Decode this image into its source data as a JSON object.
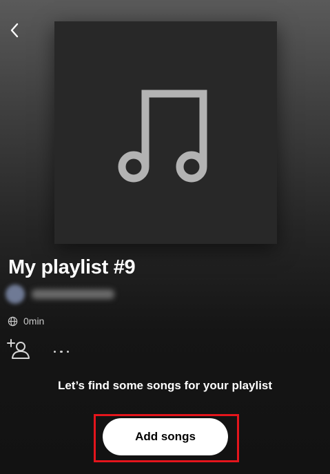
{
  "header": {
    "back_icon": "chevron-left-icon"
  },
  "cover": {
    "icon": "music-note-icon",
    "background_color": "#282828",
    "icon_color": "#b3b3b3"
  },
  "playlist": {
    "title": "My playlist #9",
    "duration": "0min",
    "visibility_icon": "globe-icon"
  },
  "actions": {
    "add_collaborator_icon": "add-user-icon",
    "more_icon": "more-dots-icon"
  },
  "empty_state": {
    "message": "Let’s find some songs for your playlist",
    "button_label": "Add songs"
  },
  "colors": {
    "highlight": "#e4151c",
    "button_bg": "#ffffff",
    "background": "#121212"
  }
}
